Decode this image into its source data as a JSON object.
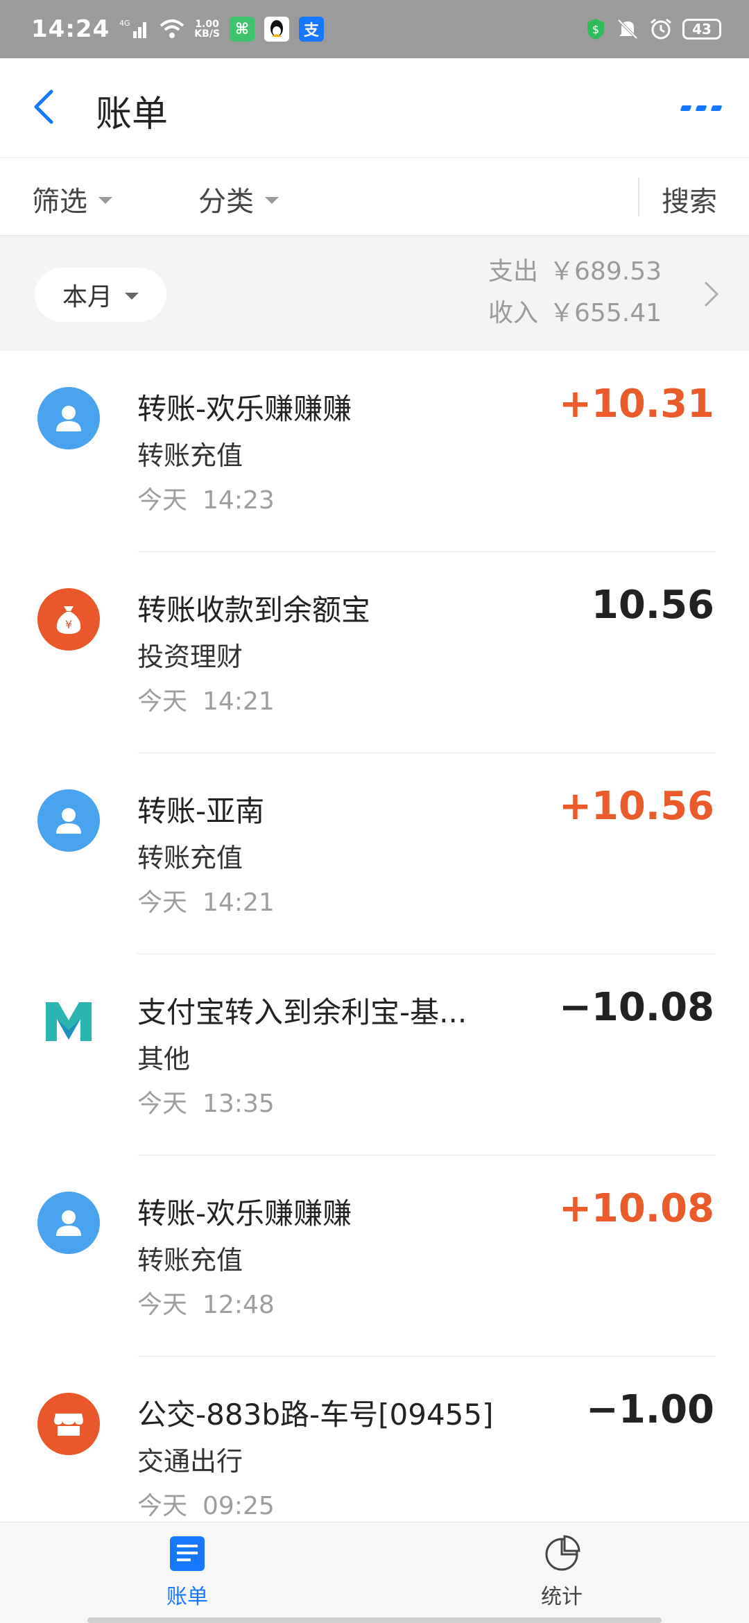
{
  "status_bar": {
    "time": "14:24",
    "network_type": "4G",
    "net_speed_value": "1.00",
    "net_speed_unit": "KB/S",
    "battery": "43",
    "app_icons": [
      "cat-app-icon",
      "qq-icon",
      "alipay-icon"
    ],
    "right_icons": [
      "shield-dollar-icon",
      "mute-icon",
      "alarm-icon"
    ]
  },
  "header": {
    "title": "账单"
  },
  "filters": {
    "filter_label": "筛选",
    "category_label": "分类",
    "search_label": "搜索"
  },
  "summary": {
    "period": "本月",
    "expense_label": "支出",
    "expense_amount": "￥689.53",
    "income_label": "收入",
    "income_amount": "￥655.41"
  },
  "transactions": [
    {
      "title": "转账-欢乐赚赚赚",
      "category": "转账充值",
      "day": "今天",
      "time": "14:23",
      "amount": "+10.31",
      "icon": "person-avatar-icon",
      "color": "#4aa3ee"
    },
    {
      "title": "转账收款到余额宝",
      "category": "投资理财",
      "day": "今天",
      "time": "14:21",
      "amount": "10.56",
      "icon": "money-bag-icon",
      "color": "#e9572a"
    },
    {
      "title": "转账-亚南",
      "category": "转账充值",
      "day": "今天",
      "time": "14:21",
      "amount": "+10.56",
      "icon": "person-avatar-icon",
      "color": "#4aa3ee"
    },
    {
      "title": "支付宝转入到余利宝-基...",
      "category": "其他",
      "day": "今天",
      "time": "13:35",
      "amount": "−10.08",
      "icon": "mybank-logo-icon",
      "color": "#2bb5b0"
    },
    {
      "title": "转账-欢乐赚赚赚",
      "category": "转账充值",
      "day": "今天",
      "time": "12:48",
      "amount": "+10.08",
      "icon": "person-avatar-icon",
      "color": "#4aa3ee"
    },
    {
      "title": "公交-883b路-车号[09455]",
      "category": "交通出行",
      "day": "今天",
      "time": "09:25",
      "amount": "−1.00",
      "icon": "shop-icon",
      "color": "#e9572a"
    }
  ],
  "bottom_nav": {
    "tabs": [
      {
        "label": "账单",
        "icon": "bill-list-icon",
        "active": true
      },
      {
        "label": "统计",
        "icon": "pie-chart-icon",
        "active": false
      }
    ]
  },
  "colors": {
    "accent": "#1677ff",
    "income": "#ea5a2a",
    "expense": "#222222"
  }
}
